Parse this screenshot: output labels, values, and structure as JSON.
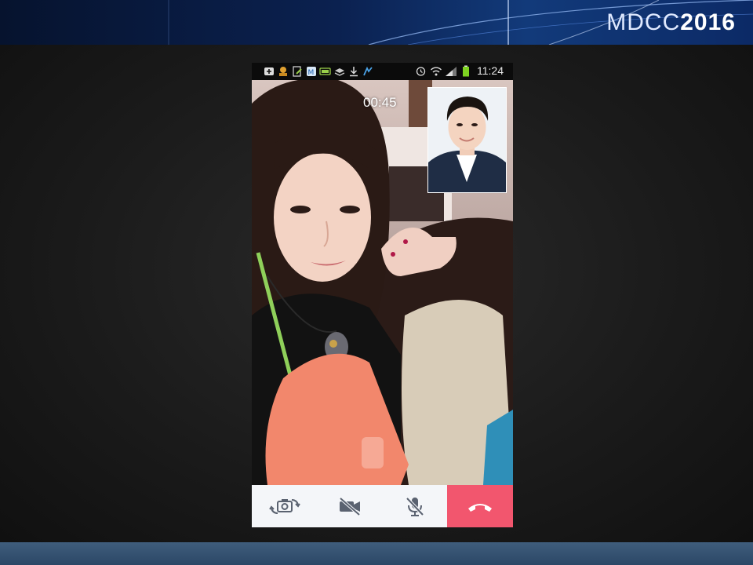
{
  "slide": {
    "brand_light": "MDCC",
    "brand_bold": "2016"
  },
  "status_bar": {
    "time": "11:24",
    "left_icons": [
      "plus-box-icon",
      "app-icon",
      "document-edit-icon",
      "maps-icon",
      "battery-saver-icon",
      "layers-icon",
      "download-icon",
      "bluetooth-tag-icon"
    ],
    "right_icons": [
      "alarm-icon",
      "wifi-icon",
      "signal-icon",
      "battery-icon"
    ],
    "battery_color": "#7ed321"
  },
  "call": {
    "duration": "00:45"
  },
  "controls": [
    {
      "name": "switch-camera-button",
      "icon": "camera-switch-icon"
    },
    {
      "name": "video-off-button",
      "icon": "video-off-icon"
    },
    {
      "name": "mute-button",
      "icon": "mic-off-icon"
    },
    {
      "name": "hang-up-button",
      "icon": "phone-hangup-icon"
    }
  ],
  "colors": {
    "hangup": "#f2566e",
    "control_bg": "#f4f6f9",
    "control_icon": "#5a6270"
  }
}
